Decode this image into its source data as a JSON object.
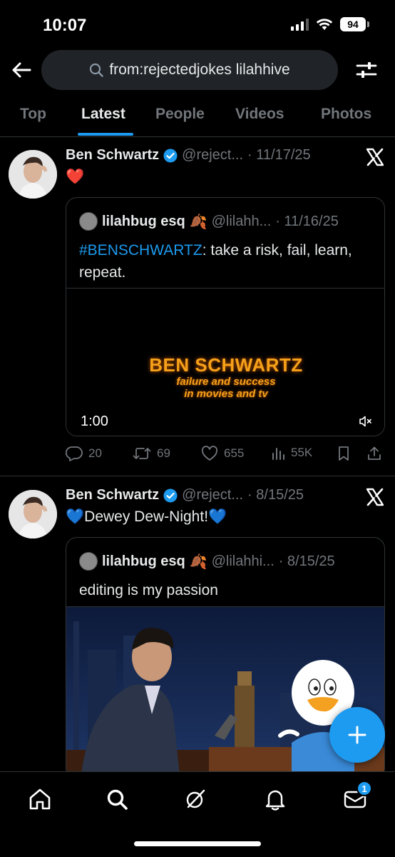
{
  "status_bar": {
    "time": "10:07",
    "battery": "94"
  },
  "search": {
    "query": "from:rejectedjokes lilahhive"
  },
  "tabs": [
    {
      "label": "Top"
    },
    {
      "label": "Latest"
    },
    {
      "label": "People"
    },
    {
      "label": "Videos"
    },
    {
      "label": "Photos"
    }
  ],
  "active_tab": "Latest",
  "colors": {
    "accent": "#1d9bf0",
    "text": "#e7e9ea",
    "muted": "#71767b",
    "border": "#2f3336",
    "video_title": "#f6a11a"
  },
  "tweets": [
    {
      "name": "Ben Schwartz",
      "handle": "@reject...",
      "date": "· 11/17/25",
      "text": "❤️",
      "quote": {
        "name": "lilahbug esq",
        "emoji": "🍂",
        "handle": "@lilahh...",
        "date": "· 11/16/25",
        "hashtag": "#BENSCHWARTZ",
        "text": ": take a risk, fail, learn, repeat.",
        "video": {
          "title": "BEN SCHWARTZ",
          "subtitle_line1": "failure and success",
          "subtitle_line2": "in movies and tv",
          "duration": "1:00"
        }
      },
      "stats": {
        "replies": "20",
        "reposts": "69",
        "likes": "655",
        "views": "55K"
      }
    },
    {
      "name": "Ben Schwartz",
      "handle": "@reject...",
      "date": "· 8/15/25",
      "text": "💙Dewey Dew-Night!💙",
      "quote": {
        "name": "lilahbug esq",
        "emoji": "🍂",
        "handle": "@lilahhi...",
        "date": "· 8/15/25",
        "text": "editing is my passion"
      }
    }
  ],
  "bottom_nav": {
    "items": [
      "home-icon",
      "search-icon",
      "grok-icon",
      "notifications-icon",
      "messages-icon"
    ],
    "messages_badge": "1"
  }
}
